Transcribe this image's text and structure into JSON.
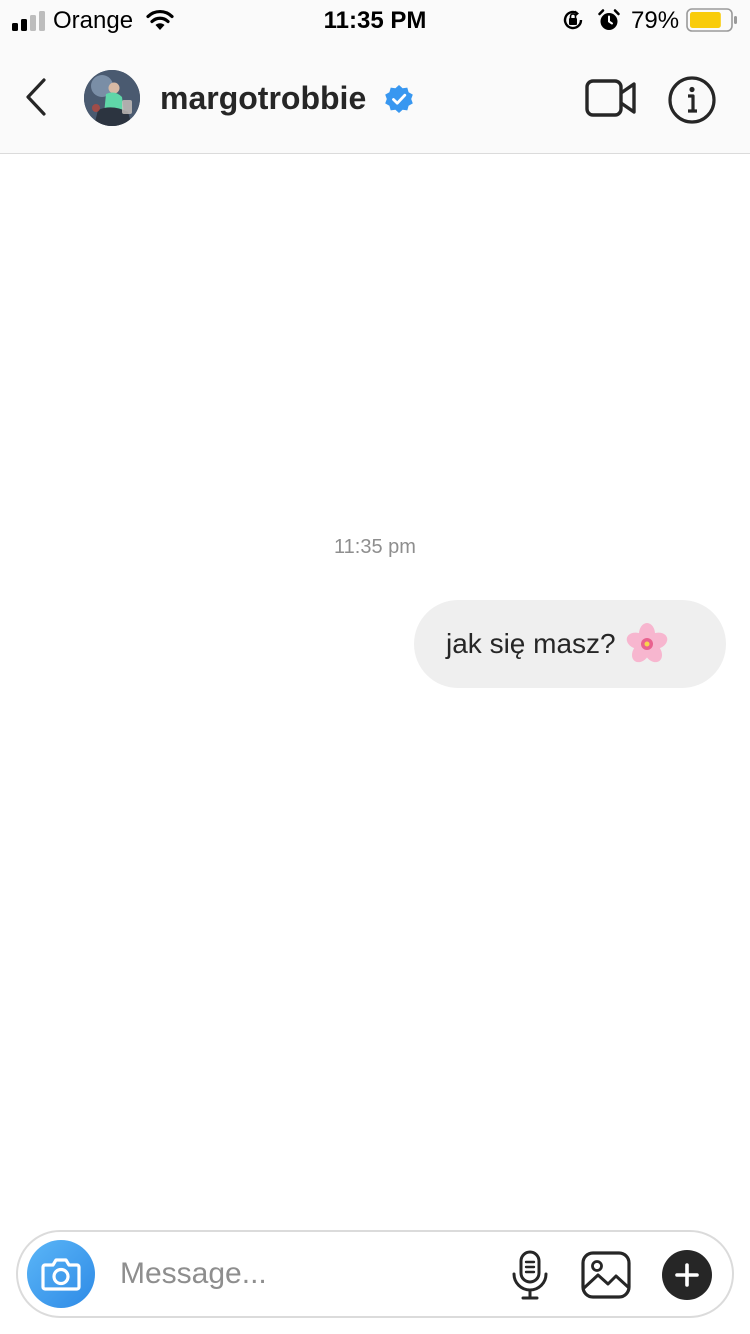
{
  "status_bar": {
    "carrier": "Orange",
    "time": "11:35 PM",
    "battery_percent": "79%",
    "battery_level": 0.79,
    "battery_color": "#f9cc0a",
    "icons": [
      "signal-icon",
      "wifi-icon",
      "orientation-lock-icon",
      "alarm-icon",
      "battery-icon"
    ]
  },
  "header": {
    "username": "margotrobbie",
    "verified": true,
    "verified_color": "#3897f0",
    "icons": [
      "back-chevron-icon",
      "video-camera-icon",
      "info-icon"
    ]
  },
  "conversation": {
    "timestamp": "11:35 pm",
    "messages": [
      {
        "text": "jak się masz?",
        "emoji": "cherry-blossom",
        "sender": "me"
      }
    ]
  },
  "composer": {
    "placeholder": "Message...",
    "value": "",
    "camera_color": "#3897f0",
    "icons": [
      "camera-icon",
      "microphone-icon",
      "gallery-icon",
      "plus-icon"
    ]
  }
}
